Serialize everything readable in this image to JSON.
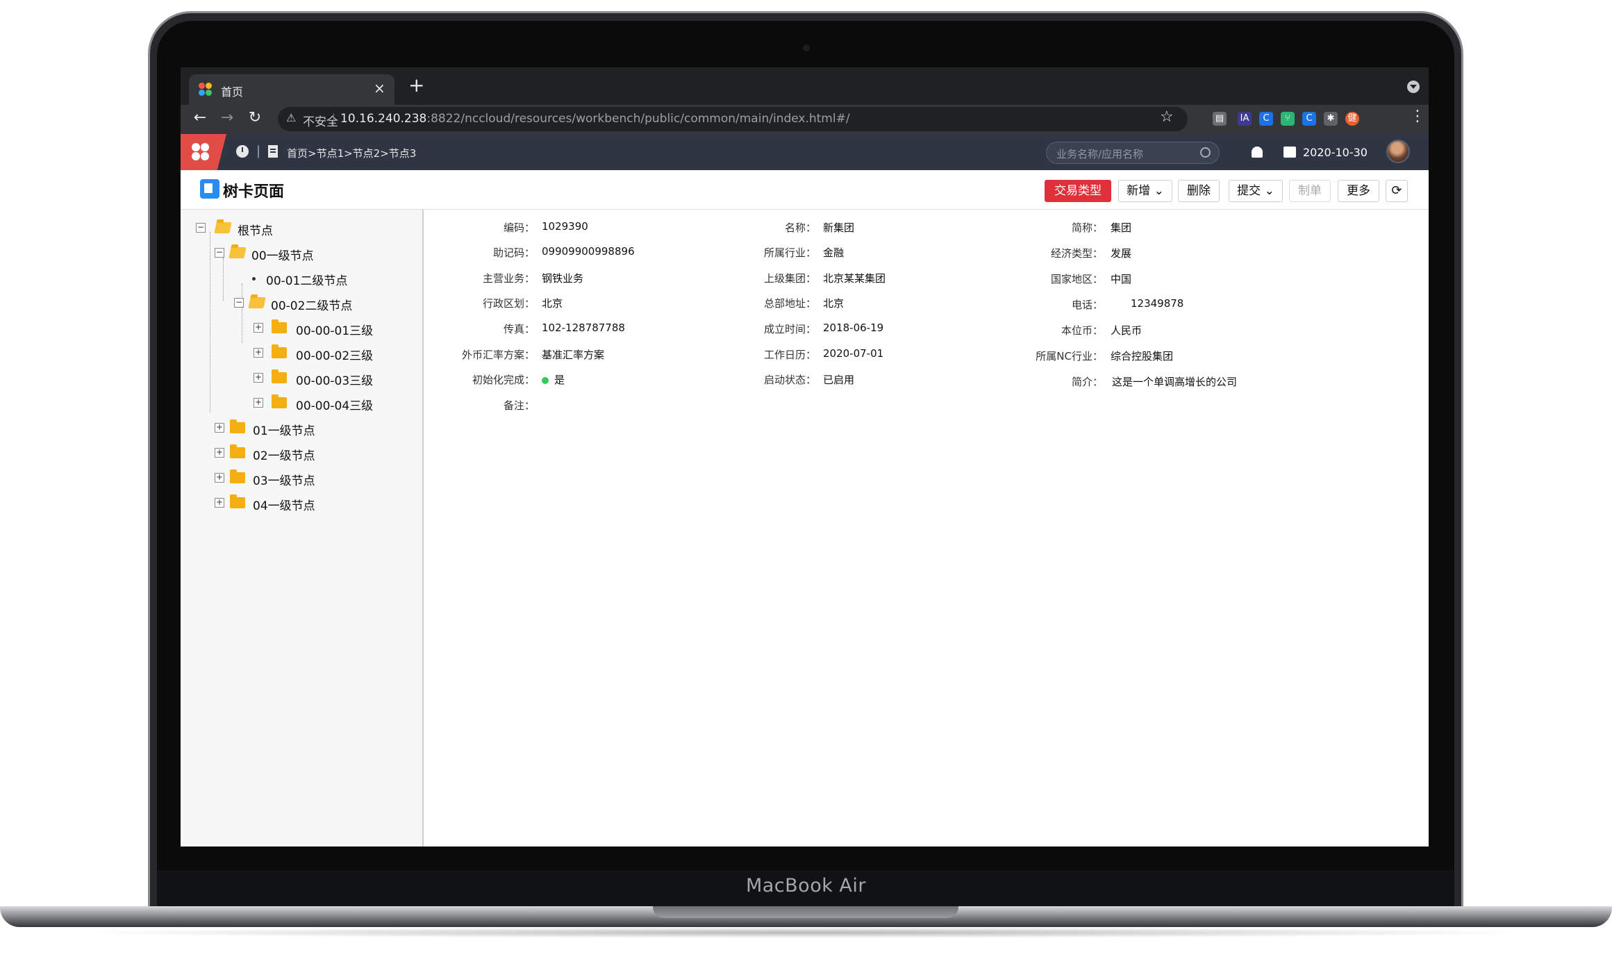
{
  "device": {
    "brand": "MacBook Air"
  },
  "browser": {
    "tab_title": "首页",
    "tab_close": "×",
    "new_tab": "+",
    "nav": {
      "back": "←",
      "forward": "→",
      "reload": "↻"
    },
    "security_label": "不安全",
    "url_host": "10.16.240.238",
    "url_rest": ":8822/nccloud/resources/workbench/public/common/main/index.html#/",
    "star": "☆",
    "extensions": [
      {
        "icon": "reader-icon",
        "text": "▤",
        "color": "#6b6e73"
      },
      {
        "icon": "ia-icon",
        "text": "IA",
        "color": "#3d3a8f"
      },
      {
        "icon": "c-blue-icon",
        "text": "C",
        "color": "#1f6fe5"
      },
      {
        "icon": "fork-icon",
        "text": "⑂",
        "color": "#2bb673"
      },
      {
        "icon": "c-circle-icon",
        "text": "C",
        "color": "#1a73e8"
      },
      {
        "icon": "puzzle-icon",
        "text": "✱",
        "color": "#5f6368"
      },
      {
        "icon": "profile-icon",
        "text": "健",
        "color": "#e8602c"
      }
    ],
    "menu": "⋮"
  },
  "app": {
    "breadcrumb": "首页>节点1>节点2>节点3",
    "search_placeholder": "业务名称/应用名称",
    "date": "2020-10-30",
    "colors": {
      "header": "#2f3543",
      "logo": "#e14c46",
      "primary": "#e0303b"
    }
  },
  "page": {
    "title": "树卡页面",
    "buttons": {
      "trade_type": "交易类型",
      "add": "新增",
      "delete": "删除",
      "submit": "提交",
      "make": "制单",
      "more": "更多",
      "refresh": "⟳"
    }
  },
  "tree": {
    "root": "根节点",
    "n00": "00一级节点",
    "n0001": "00-01二级节点",
    "n0002": "00-02二级节点",
    "n000001": "00-00-01三级",
    "n000002": "00-00-02三级",
    "n000003": "00-00-03三级",
    "n000004": "00-00-04三级",
    "n01": "01一级节点",
    "n02": "02一级节点",
    "n03": "03一级节点",
    "n04": "04一级节点"
  },
  "form": {
    "code_l": "编码：",
    "code_v": "1029390",
    "name_l": "名称：",
    "name_v": "新集团",
    "short_l": "简称：",
    "short_v": "集团",
    "mnemonic_l": "助记码：",
    "mnemonic_v": "09909900998896",
    "industry_l": "所属行业：",
    "industry_v": "金融",
    "econ_l": "经济类型：",
    "econ_v": "发展",
    "business_l": "主营业务：",
    "business_v": "钢铁业务",
    "parent_l": "上级集团：",
    "parent_v": "北京某某集团",
    "country_l": "国家地区：",
    "country_v": "中国",
    "region_l": "行政区划：",
    "region_v": "北京",
    "hq_l": "总部地址：",
    "hq_v": "北京",
    "phone_l": "电话：",
    "phone_v": "12349878",
    "fax_l": "传真：",
    "fax_v": "102-128787788",
    "founded_l": "成立时间：",
    "founded_v": "2018-06-19",
    "currency_l": "本位币：",
    "currency_v": "人民币",
    "fx_l": "外币汇率方案：",
    "fx_v": "基准汇率方案",
    "calendar_l": "工作日历：",
    "calendar_v": "2020-07-01",
    "nc_l": "所属NC行业：",
    "nc_v": "综合控股集团",
    "init_l": "初始化完成：",
    "init_v": "是",
    "status_l": "启动状态：",
    "status_v": "已启用",
    "intro_l": "简介：",
    "intro_v": "这是一个单调高增长的公司",
    "remark_l": "备注："
  }
}
